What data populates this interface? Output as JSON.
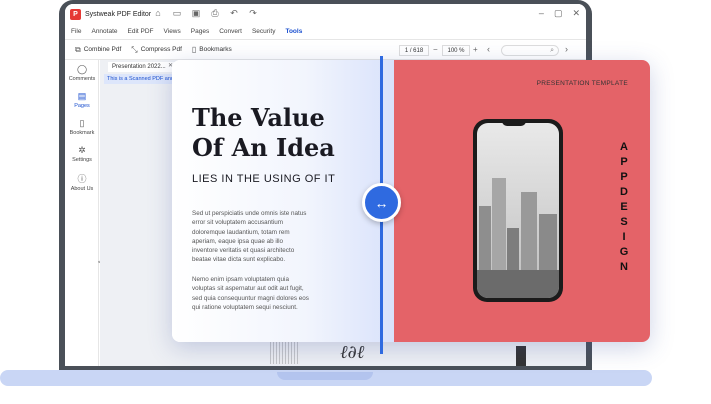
{
  "app": {
    "title": "Systweak PDF Editor",
    "logo_letter": "P"
  },
  "titlebar": {
    "icons": [
      "home-icon",
      "folder-icon",
      "save-icon",
      "print-icon",
      "undo-icon",
      "redo-icon"
    ],
    "glyphs": [
      "⌂",
      "▭",
      "▣",
      "⎙",
      "↶",
      "↷"
    ],
    "window_controls": [
      "–",
      "▢",
      "✕"
    ]
  },
  "menu": [
    "File",
    "Annotate",
    "Edit PDF",
    "Views",
    "Pages",
    "Convert",
    "Security",
    "Tools"
  ],
  "menu_active": "Tools",
  "toolbar": {
    "combine_label": "Combine Pdf",
    "compress_label": "Compress Pdf",
    "bookmarks_label": "Bookmarks",
    "page_value": "1 / 618",
    "zoom_value": "100 %",
    "zoom_minus": "−",
    "zoom_plus": "+",
    "prev": "‹",
    "next": "›",
    "search_icon": "⌕"
  },
  "sidebar": {
    "items": [
      {
        "label": "Comments",
        "icon": "comment-icon",
        "glyph": "◯"
      },
      {
        "label": "Pages",
        "icon": "pages-icon",
        "glyph": "▤"
      },
      {
        "label": "Bookmark",
        "icon": "bookmark-icon",
        "glyph": "▯"
      },
      {
        "label": "Settings",
        "icon": "gear-icon",
        "glyph": "✲"
      },
      {
        "label": "About Us",
        "icon": "info-icon",
        "glyph": "ⓘ"
      }
    ],
    "active": "Pages",
    "collapse": "<>"
  },
  "document": {
    "tab_label": "Presentation 2022...",
    "tab_close": "✕",
    "notice": "This is a Scanned PDF and t"
  },
  "preview": {
    "title_line1": "The Value",
    "title_line2": "Of An Idea",
    "subtitle": "LIES IN THE USING OF IT",
    "paragraph1": "Sed ut perspiciatis unde omnis iste natus error sit voluptatem accusantium doloremque laudantium, totam rem aperiam, eaque ipsa quae ab illo inventore veritatis et quasi architecto beatae vitae dicta sunt explicabo.",
    "paragraph2": "Nemo enim ipsam voluptatem quia voluptas sit aspernatur aut odit aut fugit, sed quia consequuntur magni dolores eos qui ratione voluptatem sequi nesciunt.",
    "template_label": "PRESENTATION TEMPLATE",
    "vertical_letters": [
      "A",
      "P",
      "P",
      "D",
      "E",
      "S",
      "I",
      "G",
      "N"
    ],
    "handle_glyph": "↔",
    "colors": {
      "accent": "#2f6ae0",
      "slide_red": "#e46368"
    }
  }
}
